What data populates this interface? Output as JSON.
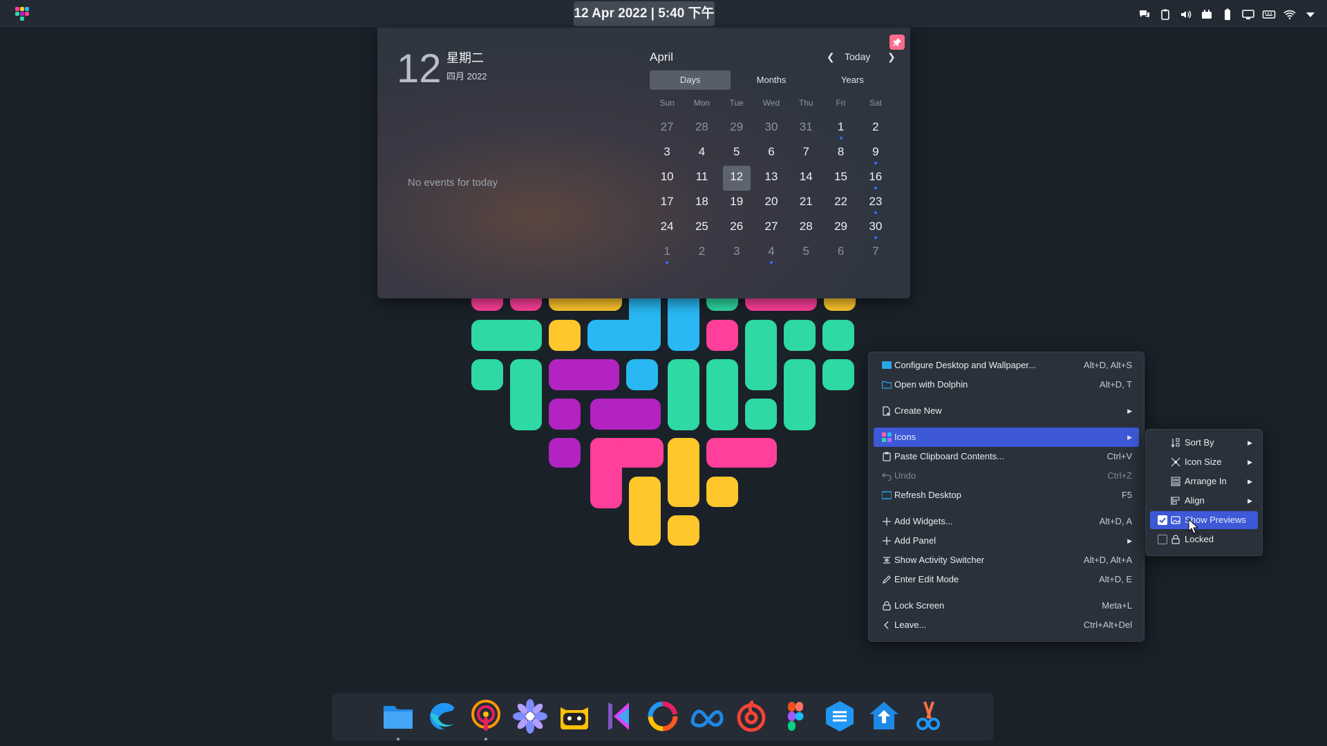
{
  "top_panel": {
    "clock": "12 Apr 2022 | 5:40 下午",
    "tray_icons": [
      "kdeconnect-icon",
      "clipboard-icon",
      "volume-icon",
      "battery-charging-icon",
      "battery-icon",
      "display-icon",
      "keyboard-icon",
      "wifi-icon",
      "expand-tray-icon"
    ]
  },
  "calendar": {
    "day_number": "12",
    "weekday": "星期二",
    "month_year": "四月 2022",
    "no_events": "No events for today",
    "month_title": "April",
    "today_label": "Today",
    "tabs": [
      "Days",
      "Months",
      "Years"
    ],
    "weekdays": [
      "Sun",
      "Mon",
      "Tue",
      "Wed",
      "Thu",
      "Fri",
      "Sat"
    ],
    "weeks": [
      [
        {
          "d": "27",
          "dim": true
        },
        {
          "d": "28",
          "dim": true
        },
        {
          "d": "29",
          "dim": true
        },
        {
          "d": "30",
          "dim": true
        },
        {
          "d": "31",
          "dim": true
        },
        {
          "d": "1",
          "dot": true
        },
        {
          "d": "2"
        }
      ],
      [
        {
          "d": "3"
        },
        {
          "d": "4"
        },
        {
          "d": "5"
        },
        {
          "d": "6"
        },
        {
          "d": "7"
        },
        {
          "d": "8"
        },
        {
          "d": "9",
          "dot": true
        }
      ],
      [
        {
          "d": "10"
        },
        {
          "d": "11"
        },
        {
          "d": "12",
          "today": true
        },
        {
          "d": "13"
        },
        {
          "d": "14"
        },
        {
          "d": "15"
        },
        {
          "d": "16",
          "dot": true
        }
      ],
      [
        {
          "d": "17"
        },
        {
          "d": "18"
        },
        {
          "d": "19"
        },
        {
          "d": "20"
        },
        {
          "d": "21"
        },
        {
          "d": "22"
        },
        {
          "d": "23",
          "dot": true
        }
      ],
      [
        {
          "d": "24"
        },
        {
          "d": "25"
        },
        {
          "d": "26"
        },
        {
          "d": "27"
        },
        {
          "d": "28"
        },
        {
          "d": "29"
        },
        {
          "d": "30",
          "dot": true
        }
      ],
      [
        {
          "d": "1",
          "dim": true,
          "dot": true
        },
        {
          "d": "2",
          "dim": true
        },
        {
          "d": "3",
          "dim": true
        },
        {
          "d": "4",
          "dim": true,
          "dot": true
        },
        {
          "d": "5",
          "dim": true
        },
        {
          "d": "6",
          "dim": true
        },
        {
          "d": "7",
          "dim": true
        }
      ]
    ]
  },
  "context_menu": {
    "items": [
      {
        "label": "Configure Desktop and Wallpaper...",
        "shortcut": "Alt+D, Alt+S",
        "icon": "wallpaper-icon"
      },
      {
        "label": "Open with Dolphin",
        "shortcut": "Alt+D, T",
        "icon": "folder-icon"
      },
      {
        "label": "Create New",
        "shortcut": "",
        "icon": "new-document-icon",
        "submenu": true
      },
      {
        "label": "Icons",
        "shortcut": "",
        "icon": "grid-icon",
        "submenu": true,
        "highlighted": true
      },
      {
        "label": "Paste Clipboard Contents...",
        "shortcut": "Ctrl+V",
        "icon": "paste-icon"
      },
      {
        "label": "Undo",
        "shortcut": "Ctrl+Z",
        "icon": "undo-icon",
        "disabled": true
      },
      {
        "label": "Refresh Desktop",
        "shortcut": "F5",
        "icon": "refresh-icon"
      },
      {
        "label": "Add Widgets...",
        "shortcut": "Alt+D, A",
        "icon": "plus-icon"
      },
      {
        "label": "Add Panel",
        "shortcut": "",
        "icon": "plus-icon",
        "submenu": true
      },
      {
        "label": "Show Activity Switcher",
        "shortcut": "Alt+D, Alt+A",
        "icon": "activities-icon"
      },
      {
        "label": "Enter Edit Mode",
        "shortcut": "Alt+D, E",
        "icon": "pencil-icon"
      },
      {
        "label": "Lock Screen",
        "shortcut": "Meta+L",
        "icon": "lock-icon"
      },
      {
        "label": "Leave...",
        "shortcut": "Ctrl+Alt+Del",
        "icon": "chevron-left-icon"
      }
    ]
  },
  "icons_submenu": {
    "items": [
      {
        "label": "Sort By",
        "icon": "sort-icon",
        "submenu": true
      },
      {
        "label": "Icon Size",
        "icon": "resize-icon",
        "submenu": true
      },
      {
        "label": "Arrange In",
        "icon": "arrange-icon",
        "submenu": true
      },
      {
        "label": "Align",
        "icon": "align-icon",
        "submenu": true
      },
      {
        "label": "Show Previews",
        "icon": "image-icon",
        "checked": true,
        "highlighted": true
      },
      {
        "label": "Locked",
        "icon": "lock-icon",
        "checked": false
      }
    ]
  },
  "dock": {
    "apps": [
      {
        "name": "dolphin-files-icon",
        "running": true
      },
      {
        "name": "edge-browser-icon"
      },
      {
        "name": "podcast-icon",
        "running": true
      },
      {
        "name": "flower-app-icon"
      },
      {
        "name": "cat-app-icon"
      },
      {
        "name": "kdevelop-icon"
      },
      {
        "name": "color-ring-icon"
      },
      {
        "name": "meta-icon"
      },
      {
        "name": "netease-music-icon"
      },
      {
        "name": "figma-icon"
      },
      {
        "name": "notes-app-icon"
      },
      {
        "name": "home-arrow-app-icon"
      },
      {
        "name": "screenshot-scissors-icon"
      }
    ]
  }
}
